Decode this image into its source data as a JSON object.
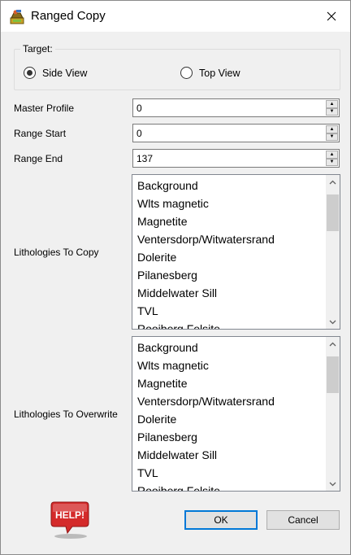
{
  "window": {
    "title": "Ranged Copy"
  },
  "target": {
    "title": "Target:",
    "options": [
      {
        "label": "Side View",
        "selected": true
      },
      {
        "label": "Top View",
        "selected": false
      }
    ]
  },
  "fields": {
    "master_profile": {
      "label": "Master Profile",
      "value": "0"
    },
    "range_start": {
      "label": "Range Start",
      "value": "0"
    },
    "range_end": {
      "label": "Range End",
      "value": "137"
    }
  },
  "lithologies_copy": {
    "label": "Lithologies To Copy",
    "items": [
      "Background",
      "Wlts magnetic",
      "Magnetite",
      "Ventersdorp/Witwatersrand",
      "Dolerite",
      "Pilanesberg",
      "Middelwater Sill",
      "TVL",
      "Rooiberg Felsite"
    ]
  },
  "lithologies_overwrite": {
    "label": "Lithologies To Overwrite",
    "items": [
      "Background",
      "Wlts magnetic",
      "Magnetite",
      "Ventersdorp/Witwatersrand",
      "Dolerite",
      "Pilanesberg",
      "Middelwater Sill",
      "TVL",
      "Rooiberg Felsite"
    ]
  },
  "buttons": {
    "help": "HELP!",
    "ok": "OK",
    "cancel": "Cancel"
  },
  "colors": {
    "accent": "#0078d7",
    "help_red": "#d42a2a"
  }
}
